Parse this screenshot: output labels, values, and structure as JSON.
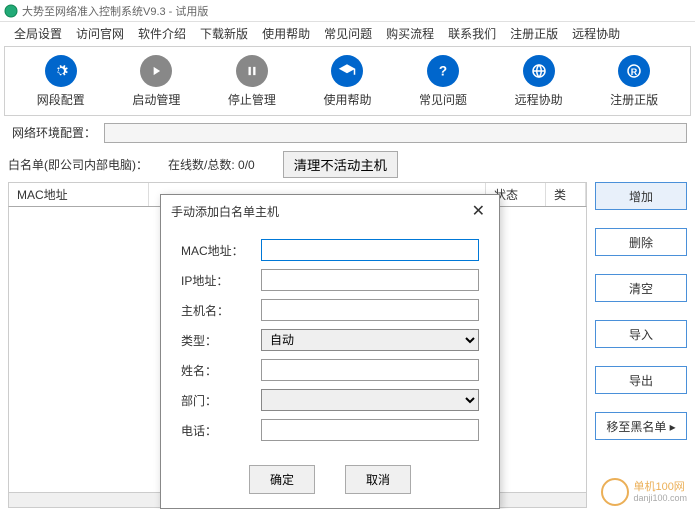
{
  "title": "大势至网络准入控制系统V9.3 - 试用版",
  "menu": [
    "全局设置",
    "访问官网",
    "软件介绍",
    "下载新版",
    "使用帮助",
    "常见问题",
    "购买流程",
    "联系我们",
    "注册正版",
    "远程协助"
  ],
  "toolbar": [
    {
      "label": "网段配置",
      "icon": "gear",
      "color": "blue"
    },
    {
      "label": "启动管理",
      "icon": "play",
      "color": "gray"
    },
    {
      "label": "停止管理",
      "icon": "pause",
      "color": "gray"
    },
    {
      "label": "使用帮助",
      "icon": "grad",
      "color": "blue"
    },
    {
      "label": "常见问题",
      "icon": "question",
      "color": "blue"
    },
    {
      "label": "远程协助",
      "icon": "globe",
      "color": "blue"
    },
    {
      "label": "注册正版",
      "icon": "reg",
      "color": "blue"
    }
  ],
  "env_label": "网络环境配置：",
  "whitelist_label": "白名单(即公司内部电脑)：",
  "online_label": "在线数/总数:",
  "online_value": "0/0",
  "clean_btn": "清理不活动主机",
  "columns": {
    "mac": "MAC地址",
    "status": "状态",
    "type": "类"
  },
  "side_btns": [
    "增加",
    "删除",
    "清空",
    "导入",
    "导出",
    "移至黑名单"
  ],
  "modal": {
    "title": "手动添加白名单主机",
    "fields": {
      "mac": "MAC地址：",
      "ip": "IP地址：",
      "host": "主机名：",
      "type": "类型：",
      "name": "姓名：",
      "dept": "部门：",
      "phone": "电话："
    },
    "type_value": "自动",
    "ok": "确定",
    "cancel": "取消"
  },
  "watermark": {
    "brand": "单机100网",
    "url": "danji100.com"
  }
}
